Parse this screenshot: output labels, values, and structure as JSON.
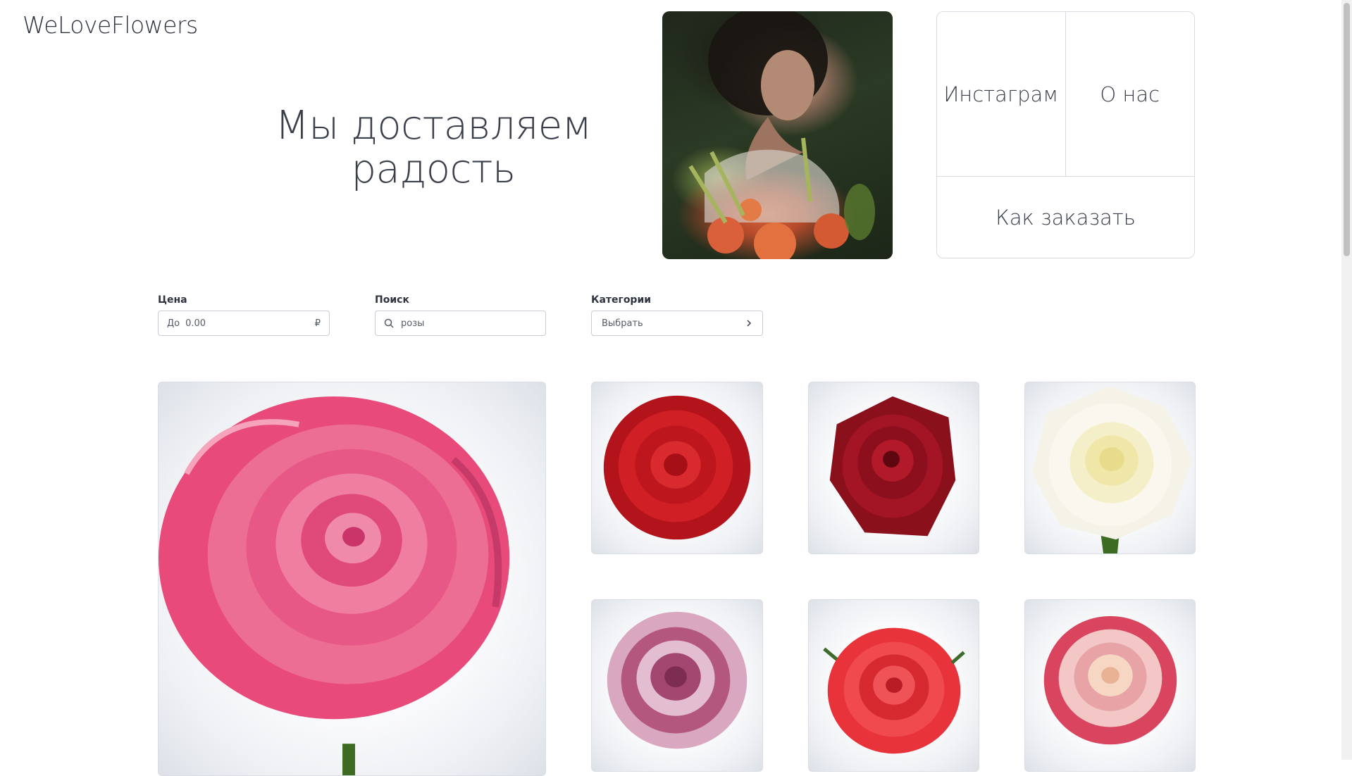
{
  "header": {
    "logo": "WeLoveFlowers",
    "hero_title_line1": "Мы доставляем",
    "hero_title_line2": "радость"
  },
  "nav": {
    "instagram": "Инстаграм",
    "about": "О нас",
    "how_to_order": "Как заказать"
  },
  "filters": {
    "price_label": "Цена",
    "price_prefix": "До",
    "price_placeholder": "0.00",
    "price_currency": "₽",
    "search_label": "Поиск",
    "search_placeholder": "розы",
    "categories_label": "Категории",
    "categories_value": "Выбрать"
  },
  "icons": {
    "search": "search-icon",
    "chevron_right": "chevron-right-icon",
    "chevron_down": "chevron-down-icon"
  },
  "products": [
    {
      "color": "#e84a7a",
      "kind": "pink-rose-large"
    },
    {
      "color": "#c4161c",
      "kind": "red-rose"
    },
    {
      "color": "#9e1322",
      "kind": "dark-red-rose"
    },
    {
      "color": "#f6f3e2",
      "kind": "white-rose"
    },
    {
      "color": "#b3577f",
      "kind": "striped-pink-rose"
    },
    {
      "color": "#e8333a",
      "kind": "coral-red-rose"
    },
    {
      "color": "#e7a3a6",
      "kind": "bicolor-rose"
    }
  ]
}
